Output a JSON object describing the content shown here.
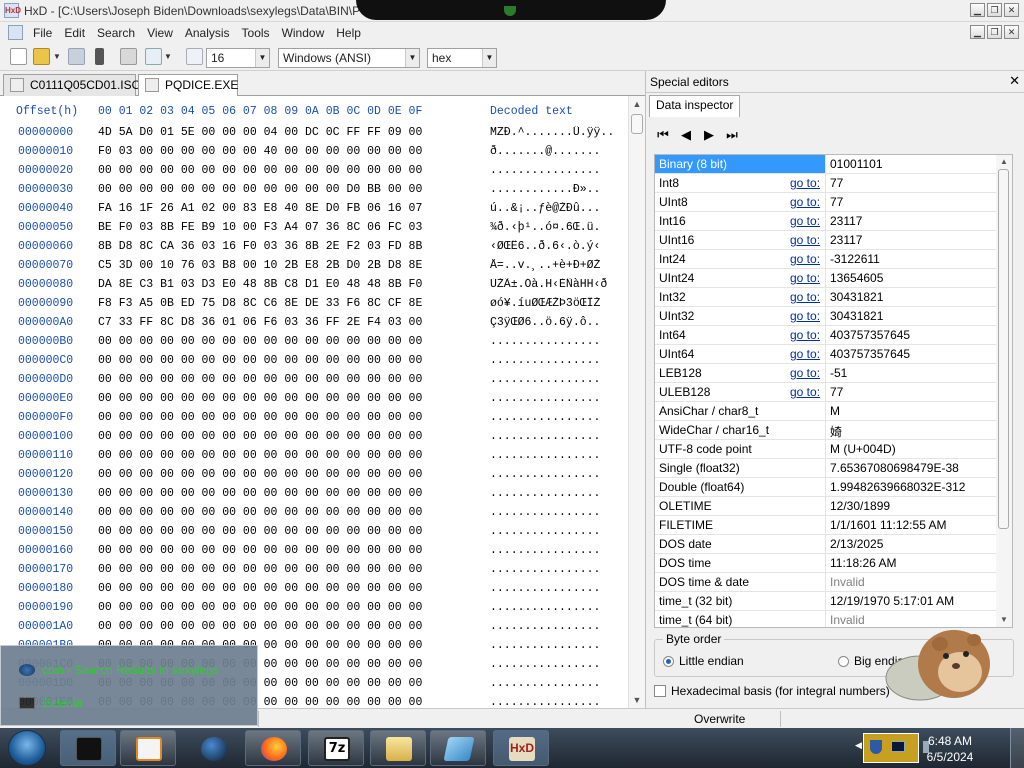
{
  "window": {
    "title": "HxD - [C:\\Users\\Joseph Biden\\Downloads\\sexylegs\\Data\\BIN\\PQDICE.E",
    "app_icon_text": "HxD"
  },
  "menu": [
    "File",
    "Edit",
    "Search",
    "View",
    "Analysis",
    "Tools",
    "Window",
    "Help"
  ],
  "toolbar": {
    "bytes_per_row": "16",
    "encoding": "Windows (ANSI)",
    "display_mode": "hex"
  },
  "tabs": [
    {
      "label": "C0111Q05CD01.ISO",
      "active": false
    },
    {
      "label": "PQDICE.EXE",
      "active": true
    }
  ],
  "hex_header": {
    "offset_label": "Offset(h)",
    "columns": "00 01 02 03 04 05 06 07 08 09 0A 0B 0C 0D 0E 0F",
    "text_label": "Decoded text"
  },
  "hex_rows": [
    {
      "offset": "00000000",
      "hex": "4D 5A D0 01 5E 00 00 00 04 00 DC 0C FF FF 09 00",
      "text": "MZÐ.^.......Ü.ÿÿ.."
    },
    {
      "offset": "00000010",
      "hex": "F0 03 00 00 00 00 00 00 40 00 00 00 00 00 00 00",
      "text": "ð.......@......."
    },
    {
      "offset": "00000020",
      "hex": "00 00 00 00 00 00 00 00 00 00 00 00 00 00 00 00",
      "text": "................"
    },
    {
      "offset": "00000030",
      "hex": "00 00 00 00 00 00 00 00 00 00 00 00 D0 BB 00 00",
      "text": "............Ð».."
    },
    {
      "offset": "00000040",
      "hex": "FA 16 1F 26 A1 02 00 83 E8 40 8E D0 FB 06 16 07",
      "text": "ú..&¡..ƒè@ŽÐû..."
    },
    {
      "offset": "00000050",
      "hex": "BE F0 03 8B FE B9 10 00 F3 A4 07 36 8C 06 FC 03",
      "text": "¾ð.‹þ¹..ó¤.6Œ.ü."
    },
    {
      "offset": "00000060",
      "hex": "8B D8 8C CA 36 03 16 F0 03 36 8B 2E F2 03 FD 8B",
      "text": "‹ØŒÊ6..ð.6‹.ò.ý‹"
    },
    {
      "offset": "00000070",
      "hex": "C5 3D 00 10 76 03 B8 00 10 2B E8 2B D0 2B D8 8E",
      "text": "Å=..v.¸..+è+Ð+ØŽ"
    },
    {
      "offset": "00000080",
      "hex": "DA 8E C3 B1 03 D3 E0 48 8B C8 D1 E0 48 48 8B F0",
      "text": "ÚŽÃ±.Óà.H‹ÈÑàHH‹ð"
    },
    {
      "offset": "00000090",
      "hex": "F8 F3 A5 0B ED 75 D8 8C C6 8E DE 33 F6 8C CF 8E",
      "text": "øó¥.íuØŒÆŽÞ3öŒÏŽ"
    },
    {
      "offset": "000000A0",
      "hex": "C7 33 FF 8C D8 36 01 06 F6 03 36 FF 2E F4 03 00",
      "text": "Ç3ÿŒØ6..ö.6ÿ.ô.."
    },
    {
      "offset": "000000B0",
      "hex": "00 00 00 00 00 00 00 00 00 00 00 00 00 00 00 00",
      "text": "................"
    },
    {
      "offset": "000000C0",
      "hex": "00 00 00 00 00 00 00 00 00 00 00 00 00 00 00 00",
      "text": "................"
    },
    {
      "offset": "000000D0",
      "hex": "00 00 00 00 00 00 00 00 00 00 00 00 00 00 00 00",
      "text": "................"
    },
    {
      "offset": "000000E0",
      "hex": "00 00 00 00 00 00 00 00 00 00 00 00 00 00 00 00",
      "text": "................"
    },
    {
      "offset": "000000F0",
      "hex": "00 00 00 00 00 00 00 00 00 00 00 00 00 00 00 00",
      "text": "................"
    },
    {
      "offset": "00000100",
      "hex": "00 00 00 00 00 00 00 00 00 00 00 00 00 00 00 00",
      "text": "................"
    },
    {
      "offset": "00000110",
      "hex": "00 00 00 00 00 00 00 00 00 00 00 00 00 00 00 00",
      "text": "................"
    },
    {
      "offset": "00000120",
      "hex": "00 00 00 00 00 00 00 00 00 00 00 00 00 00 00 00",
      "text": "................"
    },
    {
      "offset": "00000130",
      "hex": "00 00 00 00 00 00 00 00 00 00 00 00 00 00 00 00",
      "text": "................"
    },
    {
      "offset": "00000140",
      "hex": "00 00 00 00 00 00 00 00 00 00 00 00 00 00 00 00",
      "text": "................"
    },
    {
      "offset": "00000150",
      "hex": "00 00 00 00 00 00 00 00 00 00 00 00 00 00 00 00",
      "text": "................"
    },
    {
      "offset": "00000160",
      "hex": "00 00 00 00 00 00 00 00 00 00 00 00 00 00 00 00",
      "text": "................"
    },
    {
      "offset": "00000170",
      "hex": "00 00 00 00 00 00 00 00 00 00 00 00 00 00 00 00",
      "text": "................"
    },
    {
      "offset": "00000180",
      "hex": "00 00 00 00 00 00 00 00 00 00 00 00 00 00 00 00",
      "text": "................"
    },
    {
      "offset": "00000190",
      "hex": "00 00 00 00 00 00 00 00 00 00 00 00 00 00 00 00",
      "text": "................"
    },
    {
      "offset": "000001A0",
      "hex": "00 00 00 00 00 00 00 00 00 00 00 00 00 00 00 00",
      "text": "................"
    },
    {
      "offset": "000001B0",
      "hex": "00 00 00 00 00 00 00 00 00 00 00 00 00 00 00 00",
      "text": "................"
    },
    {
      "offset": "000001C0",
      "hex": "00 00 00 00 00 00 00 00 00 00 00 00 00 00 00 00",
      "text": "................"
    },
    {
      "offset": "000001D0",
      "hex": "00 00 00 00 00 00 00 00 00 00 00 00 00 00 00 00",
      "text": "................"
    },
    {
      "offset": "000001E0",
      "hex": "00 00 00 00 00 00 00 00 00 00 00 00 00 00 00 00",
      "text": "................"
    },
    {
      "offset": "000001F0",
      "hex": "00 00 00 00 00 00 00 00 00 00 00 00 00 00 00 00",
      "text": "................"
    },
    {
      "offset": "",
      "hex": "00 00 00 00 00 00 00 00 00 00 00 00 00 00 00 00",
      "text": "................"
    },
    {
      "offset": "",
      "hex": "00 00 00 00 00 00 00 00 00 00 00 00 00 00 00 00",
      "text": "................"
    },
    {
      "offset": "",
      "hex": "00 00 00 00 00 00 00 00 00 00 00 00 00 00 00 00",
      "text": "................"
    }
  ],
  "special_editors": {
    "title": "Special editors",
    "close": "✕",
    "tab": "Data inspector",
    "goto_label": "go to:",
    "rows": [
      {
        "name": "Binary (8 bit)",
        "value": "01001101",
        "goto": false,
        "selected": true
      },
      {
        "name": "Int8",
        "value": "77",
        "goto": true
      },
      {
        "name": "UInt8",
        "value": "77",
        "goto": true
      },
      {
        "name": "Int16",
        "value": "23117",
        "goto": true
      },
      {
        "name": "UInt16",
        "value": "23117",
        "goto": true
      },
      {
        "name": "Int24",
        "value": "-3122611",
        "goto": true
      },
      {
        "name": "UInt24",
        "value": "13654605",
        "goto": true
      },
      {
        "name": "Int32",
        "value": "30431821",
        "goto": true
      },
      {
        "name": "UInt32",
        "value": "30431821",
        "goto": true
      },
      {
        "name": "Int64",
        "value": "403757357645",
        "goto": true
      },
      {
        "name": "UInt64",
        "value": "403757357645",
        "goto": true
      },
      {
        "name": "LEB128",
        "value": "-51",
        "goto": true
      },
      {
        "name": "ULEB128",
        "value": "77",
        "goto": true
      },
      {
        "name": "AnsiChar / char8_t",
        "value": "M",
        "goto": false
      },
      {
        "name": "WideChar / char16_t",
        "value": "婍",
        "goto": false
      },
      {
        "name": "UTF-8 code point",
        "value": "M (U+004D)",
        "goto": false
      },
      {
        "name": "Single (float32)",
        "value": "7.65367080698479E-38",
        "goto": false
      },
      {
        "name": "Double (float64)",
        "value": "1.99482639668032E-312",
        "goto": false
      },
      {
        "name": "OLETIME",
        "value": "12/30/1899",
        "goto": false
      },
      {
        "name": "FILETIME",
        "value": "1/1/1601 11:12:55 AM",
        "goto": false
      },
      {
        "name": "DOS date",
        "value": "2/13/2025",
        "goto": false
      },
      {
        "name": "DOS time",
        "value": "11:18:26 AM",
        "goto": false
      },
      {
        "name": "DOS time & date",
        "value": "Invalid",
        "goto": false,
        "invalid": true
      },
      {
        "name": "time_t (32 bit)",
        "value": "12/19/1970 5:17:01 AM",
        "goto": false
      },
      {
        "name": "time_t (64 bit)",
        "value": "Invalid",
        "goto": false,
        "invalid": true
      }
    ],
    "byte_order_label": "Byte order",
    "little_endian": "Little endian",
    "big_endian": "Big endian",
    "hex_basis": "Hexadecimal basis (for integral numbers)"
  },
  "status": {
    "mode": "Overwrite"
  },
  "popup": [
    {
      "label": "cbin - Search Results in sexylegs"
    },
    {
      "label": "Bidenia"
    }
  ],
  "taskbar": {
    "time": "6:48 AM",
    "date": "6/5/2024"
  }
}
